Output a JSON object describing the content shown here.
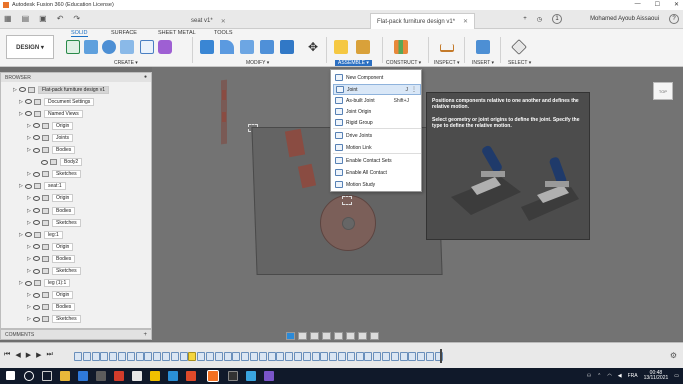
{
  "titlebar": {
    "title": "Autodesk Fusion 360 (Education License)",
    "minimize": "—",
    "maximize": "☐",
    "close": "✕"
  },
  "tabs": [
    {
      "label": "seat v1*",
      "close": "✕"
    },
    {
      "label": "Flat-pack furniture design v1*",
      "close": "✕"
    }
  ],
  "user": {
    "notifications": "1",
    "name": "Mohamed Ayoub Aissaoui",
    "help": "?"
  },
  "ribbon": {
    "workspace": "DESIGN ▾",
    "tabs": [
      "SOLID",
      "SURFACE",
      "SHEET METAL",
      "TOOLS"
    ],
    "active_tab": "SOLID",
    "groups": [
      "CREATE ▾",
      "MODIFY ▾",
      "ASSEMBLE ▾",
      "CONSTRUCT ▾",
      "INSPECT ▾",
      "INSERT ▾",
      "SELECT ▾"
    ]
  },
  "browser": {
    "title": "BROWSER",
    "rows": [
      {
        "label": "Flat-pack furniture design v1",
        "root": true
      },
      {
        "label": "Document Settings"
      },
      {
        "label": "Named Views"
      },
      {
        "label": "Origin"
      },
      {
        "label": "Joints"
      },
      {
        "label": "Bodies"
      },
      {
        "label": "Body2"
      },
      {
        "label": "Sketches"
      },
      {
        "label": "seat:1"
      },
      {
        "label": "Origin"
      },
      {
        "label": "Bodies"
      },
      {
        "label": "Sketches"
      },
      {
        "label": "leg:1"
      },
      {
        "label": "Origin"
      },
      {
        "label": "Bodies"
      },
      {
        "label": "Sketches"
      },
      {
        "label": "leg (1):1"
      },
      {
        "label": "Origin"
      },
      {
        "label": "Bodies"
      },
      {
        "label": "Sketches"
      }
    ]
  },
  "comments": {
    "label": "COMMENTS",
    "add": "+"
  },
  "assemble_menu": {
    "items": [
      {
        "label": "New Component",
        "shortcut": ""
      },
      {
        "label": "Joint",
        "shortcut": "J",
        "selected": true
      },
      {
        "label": "As-built Joint",
        "shortcut": "Shift+J"
      },
      {
        "label": "Joint Origin",
        "shortcut": ""
      },
      {
        "label": "Rigid Group",
        "shortcut": ""
      },
      {
        "label": "Drive Joints",
        "shortcut": ""
      },
      {
        "label": "Motion Link",
        "shortcut": ""
      },
      {
        "label": "Enable Contact Sets",
        "shortcut": ""
      },
      {
        "label": "Enable All Contact",
        "shortcut": ""
      },
      {
        "label": "Motion Study",
        "shortcut": ""
      }
    ]
  },
  "tooltip": {
    "line1": "Positions components relative to one another and defines the relative motion.",
    "line2": "Select geometry or joint origins to define the joint. Specify the type to define the relative motion."
  },
  "viewcube": {
    "label": "TOP"
  },
  "taskbar": {
    "language": "FRA",
    "time": "00:48",
    "date": "13/11/2021"
  }
}
